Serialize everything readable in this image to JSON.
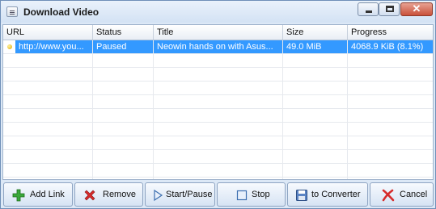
{
  "window": {
    "title": "Download Video"
  },
  "columns": [
    {
      "label": "URL"
    },
    {
      "label": "Status"
    },
    {
      "label": "Title"
    },
    {
      "label": "Size"
    },
    {
      "label": "Progress"
    }
  ],
  "rows": [
    {
      "url": "http://www.you...",
      "status": "Paused",
      "title": "Neowin hands on with Asus...",
      "size": "49.0 MiB",
      "progress": "4068.9 KiB (8.1%)",
      "selected": true
    }
  ],
  "buttons": {
    "add_link": "Add Link",
    "remove": "Remove",
    "start_pause": "Start/Pause",
    "stop": "Stop",
    "to_converter": "to Converter",
    "cancel": "Cancel"
  },
  "colors": {
    "selection": "#3399ff",
    "add": "#3aa83a",
    "remove": "#d62b2b"
  }
}
